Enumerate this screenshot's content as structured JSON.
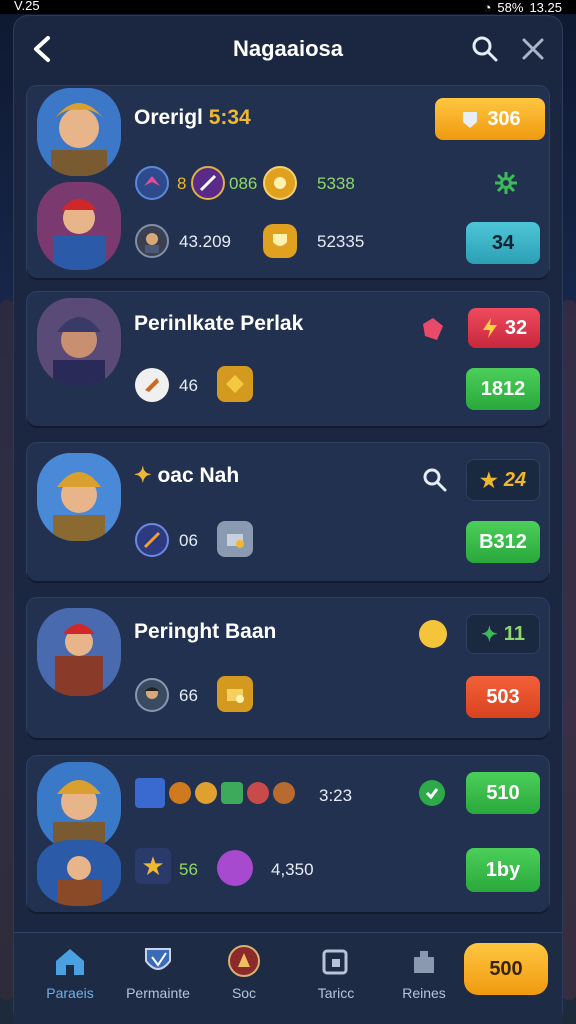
{
  "status": {
    "time_left": "V.25",
    "battery": "58%",
    "time_right": "13.25"
  },
  "header": {
    "title": "Nagaaiosa"
  },
  "cards": [
    {
      "name": "Orerigl",
      "name_hl": "5:34",
      "stat_a": "8",
      "stat_b": "086",
      "stat_c": "5338",
      "stat_d": "43.209",
      "stat_e": "52335",
      "btn_top": "306",
      "btn_bottom": "34"
    },
    {
      "name": "Perinlkate Perlak",
      "stat_a": "46",
      "btn_top": "32",
      "btn_bottom": "1812"
    },
    {
      "name": "oac Nah",
      "stat_a": "06",
      "btn_top": "24",
      "btn_bottom": "B312"
    },
    {
      "name": "Peringht Baan",
      "stat_a": "66",
      "btn_top": "11",
      "btn_bottom": "503"
    },
    {
      "name": "",
      "stat_a": "3:23",
      "stat_b": "56",
      "stat_c": "4,350",
      "btn_top": "510",
      "btn_bottom": "1by"
    }
  ],
  "nav": [
    {
      "label": "Paraeis",
      "icon": "home-icon"
    },
    {
      "label": "Permainte",
      "icon": "shield-icon"
    },
    {
      "label": "Soc",
      "icon": "badge-icon"
    },
    {
      "label": "Taricc",
      "icon": "share-icon"
    },
    {
      "label": "Reines",
      "icon": "puzzle-icon"
    }
  ],
  "nav_button": "500"
}
